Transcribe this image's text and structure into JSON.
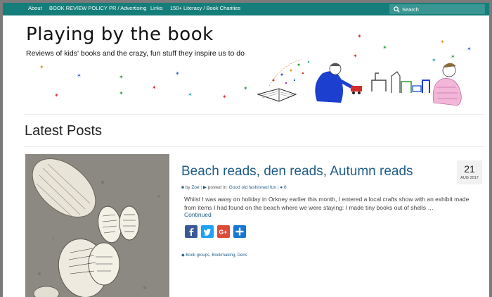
{
  "nav": {
    "items": [
      "About",
      "BOOK REVIEW POLICY",
      "PR / Advertising",
      "Links",
      "150+ Literacy / Book Charities"
    ],
    "search_placeholder": "Search"
  },
  "header": {
    "title": "Playing by the book",
    "tagline": "Reviews of kids' books and the crazy, fun stuff they inspire us to do"
  },
  "section_heading": "Latest Posts",
  "post": {
    "title": "Beach reads, den reads, Autumn reads",
    "author_prefix": "by",
    "author": "Zoe",
    "posted_in_prefix": "posted in:",
    "category": "Good old fashioned fun",
    "comment_count": "6",
    "excerpt": "Whilst I was away on holiday in Orkney earlier this month, I entered a local crafts show with an exhibit made from items I had found on the beach where we were staying: I made tiny books out of shells …",
    "continue_label": "Continued",
    "date_day": "21",
    "date_month": "AUG 2017",
    "tags": "Book groups, Bookmaking, Dens"
  },
  "share_buttons": [
    {
      "icon": "facebook-icon",
      "color": "#3b5998"
    },
    {
      "icon": "twitter-icon",
      "color": "#1da1f2"
    },
    {
      "icon": "google-plus-icon",
      "color": "#dd4b39"
    },
    {
      "icon": "share-plus-icon",
      "color": "#1877d2"
    }
  ],
  "colors": {
    "nav_bg": "#157e7a",
    "link": "#1f5d86"
  }
}
